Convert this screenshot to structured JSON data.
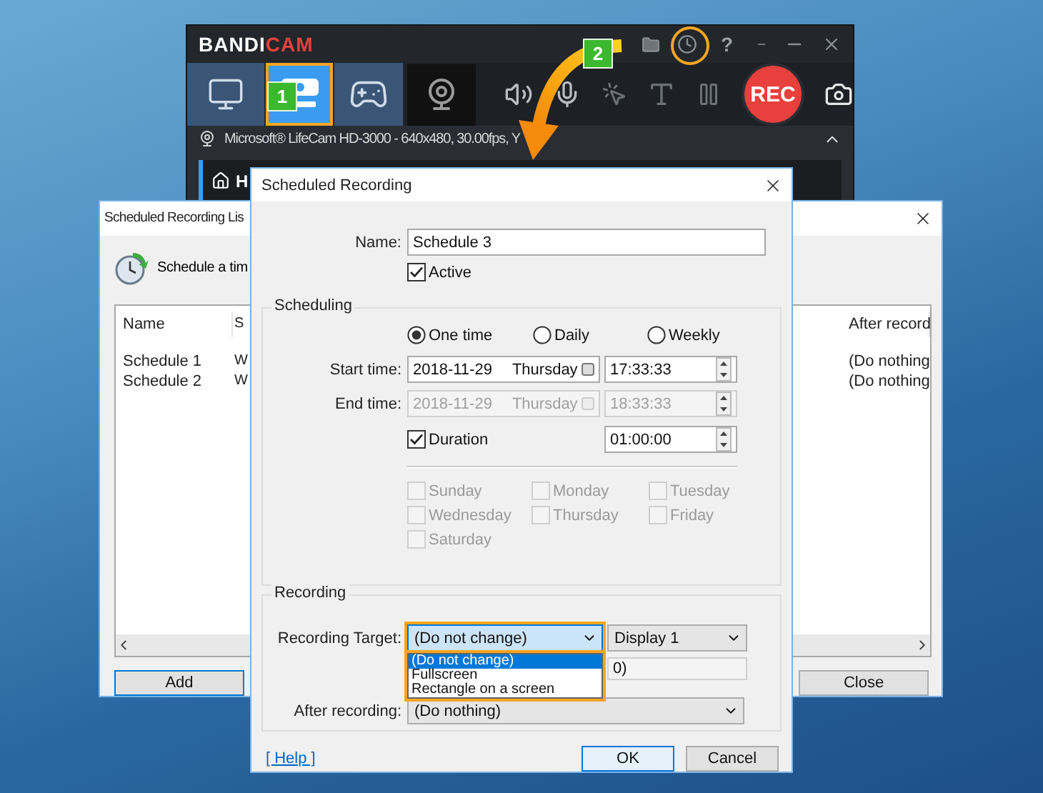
{
  "bandicam": {
    "logo_first": "BANDI",
    "logo_second": "CAM",
    "help": "?",
    "rec": "REC",
    "device": "Microsoft® LifeCam HD-3000 - 640x480, 30.00fps, Y",
    "home": "H",
    "modes": [
      {
        "kind": "screen",
        "selected": false
      },
      {
        "kind": "hdmi",
        "selected": true
      },
      {
        "kind": "game",
        "selected": false
      }
    ]
  },
  "callouts": [
    {
      "number": "1"
    },
    {
      "number": "2"
    }
  ],
  "list_window": {
    "title": "Scheduled Recording Lis",
    "toolbar_text": "Schedule a tim",
    "columns": [
      "Name",
      "S",
      "After record"
    ],
    "rows": [
      [
        "Schedule 1",
        "W",
        "(Do nothing"
      ],
      [
        "Schedule 2",
        "W",
        "(Do nothing"
      ]
    ],
    "buttons": [
      "Add",
      "Close"
    ]
  },
  "dialog": {
    "title": "Scheduled Recording",
    "name_label": "Name:",
    "name_value": "Schedule 3",
    "active": {
      "label": "Active",
      "checked": true
    },
    "scheduling": {
      "title": "Scheduling",
      "frequency": [
        {
          "label": "One time",
          "selected": true
        },
        {
          "label": "Daily",
          "selected": false
        },
        {
          "label": "Weekly",
          "selected": false
        }
      ],
      "start": {
        "label": "Start time:",
        "date": "2018-11-29",
        "weekday": "Thursday",
        "time": "17:33:33",
        "disabled": false
      },
      "end": {
        "label": "End time:",
        "date": "2018-11-29",
        "weekday": "Thursday",
        "time": "18:33:33",
        "disabled": true
      },
      "duration": {
        "label": "Duration",
        "checked": true,
        "time": "01:00:00"
      },
      "days": [
        {
          "label": "Sunday",
          "checked": false,
          "disabled": true
        },
        {
          "label": "Monday",
          "checked": false,
          "disabled": true
        },
        {
          "label": "Tuesday",
          "checked": false,
          "disabled": true
        },
        {
          "label": "Wednesday",
          "checked": false,
          "disabled": true
        },
        {
          "label": "Thursday",
          "checked": false,
          "disabled": true
        },
        {
          "label": "Friday",
          "checked": false,
          "disabled": true
        },
        {
          "label": "Saturday",
          "checked": false,
          "disabled": true
        }
      ]
    },
    "recording": {
      "title": "Recording",
      "target_label": "Recording Target:",
      "target_value": "(Do not change)",
      "expanded": true,
      "options": [
        {
          "label": "(Do not change)",
          "selected": true
        },
        {
          "label": "Fullscreen",
          "selected": false
        },
        {
          "label": "Rectangle on a screen",
          "selected": false
        }
      ],
      "display": "Display 1",
      "area_value": "0)",
      "after_label": "After recording:",
      "after_value": "(Do nothing)"
    },
    "help": "[ Help ]",
    "buttons": [
      "OK",
      "Cancel"
    ]
  }
}
